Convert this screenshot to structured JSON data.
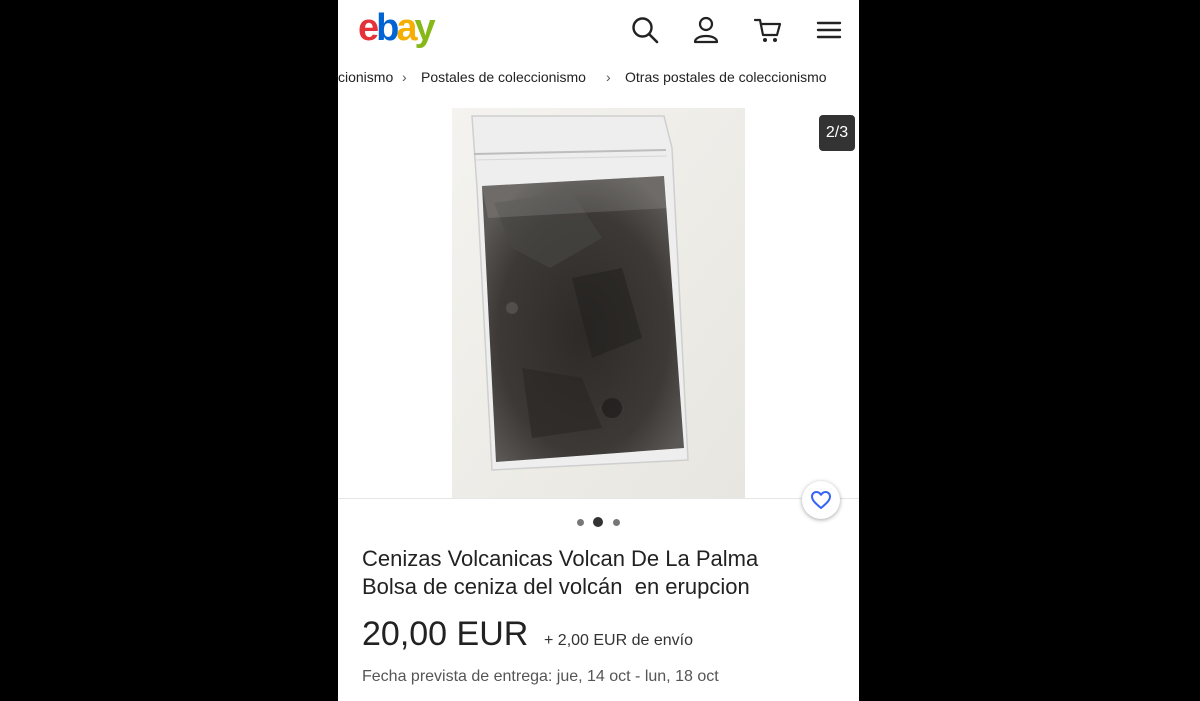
{
  "header": {
    "logo_letters": [
      "e",
      "b",
      "a",
      "y"
    ],
    "logo_colors": [
      "#e53238",
      "#0064d2",
      "#f5af02",
      "#86b817"
    ],
    "icons": [
      "search-icon",
      "account-icon",
      "cart-icon",
      "menu-icon"
    ]
  },
  "breadcrumb": {
    "items": [
      "cionismo",
      "Postales de coleccionismo",
      "Otras postales de coleccionismo"
    ],
    "separator": "›"
  },
  "gallery": {
    "counter": "2/3",
    "dots_total": 3,
    "active_dot": 2
  },
  "listing": {
    "title_line1": "Cenizas Volcanicas Volcan De La Palma",
    "title_line2": "Bolsa de ceniza del volcán  en erupcion",
    "price": "20,00 EUR",
    "shipping": "+ 2,00 EUR de envío",
    "delivery": "Fecha prevista de entrega: jue, 14 oct - lun, 18 oct"
  },
  "colors": {
    "accent": "#3665f3"
  }
}
